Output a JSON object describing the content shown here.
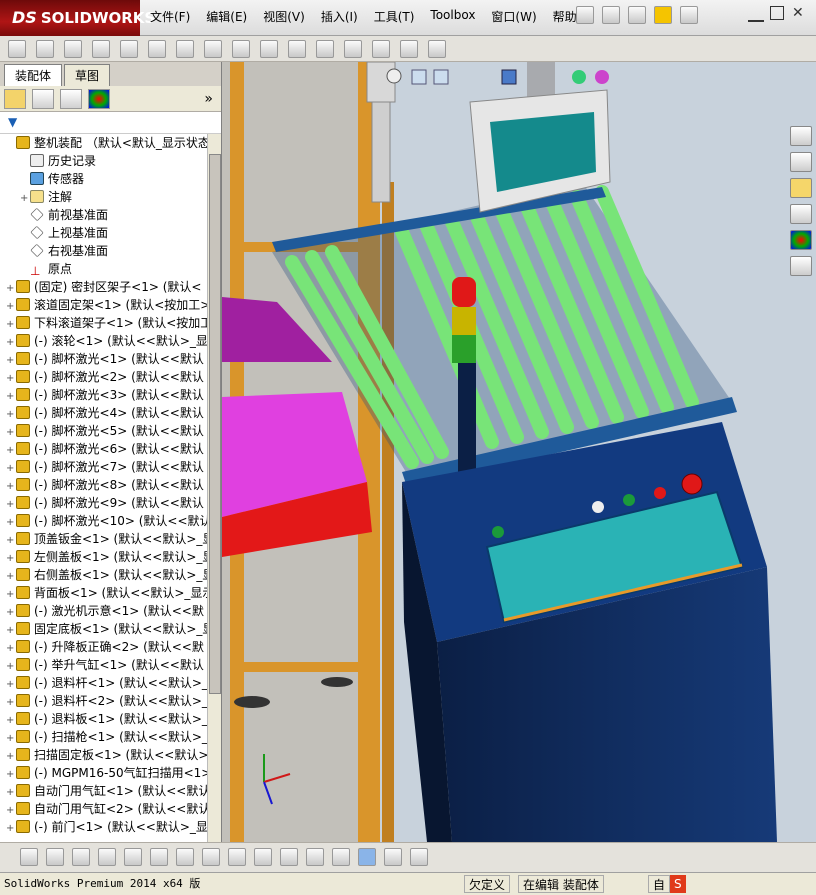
{
  "app": {
    "logo_text": "SOLIDWORKS",
    "logo_prefix": "DS"
  },
  "menu": [
    "文件(F)",
    "编辑(E)",
    "视图(V)",
    "插入(I)",
    "工具(T)",
    "Toolbox",
    "窗口(W)",
    "帮助(H)"
  ],
  "panel": {
    "tabs": [
      "装配体",
      "草图"
    ],
    "active_tab": 0
  },
  "tree": [
    {
      "label": "整机装配  （默认<默认_显示状态-",
      "icon": "assembly",
      "exp": ""
    },
    {
      "label": "历史记录",
      "icon": "history",
      "exp": ""
    },
    {
      "label": "传感器",
      "icon": "sensor",
      "exp": ""
    },
    {
      "label": "注解",
      "icon": "annotation",
      "exp": "+"
    },
    {
      "label": "前视基准面",
      "icon": "plane",
      "exp": ""
    },
    {
      "label": "上视基准面",
      "icon": "plane",
      "exp": ""
    },
    {
      "label": "右视基准面",
      "icon": "plane",
      "exp": ""
    },
    {
      "label": "原点",
      "icon": "origin",
      "exp": ""
    },
    {
      "label": "(固定) 密封区架子<1> (默认<",
      "icon": "assembly",
      "exp": "+"
    },
    {
      "label": "滚道固定架<1> (默认<按加工>",
      "icon": "assembly",
      "exp": "+"
    },
    {
      "label": "下料滚道架子<1> (默认<按加工",
      "icon": "assembly",
      "exp": "+"
    },
    {
      "label": "(-) 滚轮<1> (默认<<默认>_显",
      "icon": "assembly",
      "exp": "+"
    },
    {
      "label": "(-) 脚杯激光<1> (默认<<默认",
      "icon": "assembly",
      "exp": "+"
    },
    {
      "label": "(-) 脚杯激光<2> (默认<<默认",
      "icon": "assembly",
      "exp": "+"
    },
    {
      "label": "(-) 脚杯激光<3> (默认<<默认",
      "icon": "assembly",
      "exp": "+"
    },
    {
      "label": "(-) 脚杯激光<4> (默认<<默认",
      "icon": "assembly",
      "exp": "+"
    },
    {
      "label": "(-) 脚杯激光<5> (默认<<默认",
      "icon": "assembly",
      "exp": "+"
    },
    {
      "label": "(-) 脚杯激光<6> (默认<<默认",
      "icon": "assembly",
      "exp": "+"
    },
    {
      "label": "(-) 脚杯激光<7> (默认<<默认",
      "icon": "assembly",
      "exp": "+"
    },
    {
      "label": "(-) 脚杯激光<8> (默认<<默认",
      "icon": "assembly",
      "exp": "+"
    },
    {
      "label": "(-) 脚杯激光<9> (默认<<默认",
      "icon": "assembly",
      "exp": "+"
    },
    {
      "label": "(-) 脚杯激光<10> (默认<<默认",
      "icon": "assembly",
      "exp": "+"
    },
    {
      "label": "顶盖钣金<1> (默认<<默认>_显",
      "icon": "assembly",
      "exp": "+"
    },
    {
      "label": "左侧盖板<1> (默认<<默认>_显",
      "icon": "assembly",
      "exp": "+"
    },
    {
      "label": "右侧盖板<1> (默认<<默认>_显",
      "icon": "assembly",
      "exp": "+"
    },
    {
      "label": "背面板<1> (默认<<默认>_显示",
      "icon": "assembly",
      "exp": "+"
    },
    {
      "label": "(-) 激光机示意<1> (默认<<默",
      "icon": "assembly",
      "exp": "+"
    },
    {
      "label": "固定底板<1> (默认<<默认>_显",
      "icon": "assembly",
      "exp": "+"
    },
    {
      "label": "(-) 升降板正确<2> (默认<<默",
      "icon": "assembly",
      "exp": "+"
    },
    {
      "label": "(-) 举升气缸<1> (默认<<默认",
      "icon": "assembly",
      "exp": "+"
    },
    {
      "label": "(-) 退料杆<1> (默认<<默认>_",
      "icon": "assembly",
      "exp": "+"
    },
    {
      "label": "(-) 退料杆<2> (默认<<默认>_",
      "icon": "assembly",
      "exp": "+"
    },
    {
      "label": "(-) 退料板<1> (默认<<默认>_",
      "icon": "assembly",
      "exp": "+"
    },
    {
      "label": "(-) 扫描枪<1> (默认<<默认>_",
      "icon": "assembly",
      "exp": "+"
    },
    {
      "label": "扫描固定板<1> (默认<<默认>_",
      "icon": "assembly",
      "exp": "+"
    },
    {
      "label": "(-) MGPM16-50气缸扫描用<1>",
      "icon": "assembly",
      "exp": "+"
    },
    {
      "label": "自动门用气缸<1> (默认<<默认",
      "icon": "assembly",
      "exp": "+"
    },
    {
      "label": "自动门用气缸<2> (默认<<默认",
      "icon": "assembly",
      "exp": "+"
    },
    {
      "label": "(-) 前门<1> (默认<<默认>_显",
      "icon": "assembly",
      "exp": "+"
    }
  ],
  "status": {
    "left": "SolidWorks Premium 2014 x64 版",
    "cell1": "欠定义",
    "cell2": "在编辑 装配体",
    "cell3": "自"
  },
  "colors": {
    "roller": "#7ee07e",
    "frame": "#e39a2a",
    "cabinet": "#0f2a5a",
    "screen": "#2ab3b5",
    "magenta": "#d43ad4",
    "red": "#e0121c"
  }
}
